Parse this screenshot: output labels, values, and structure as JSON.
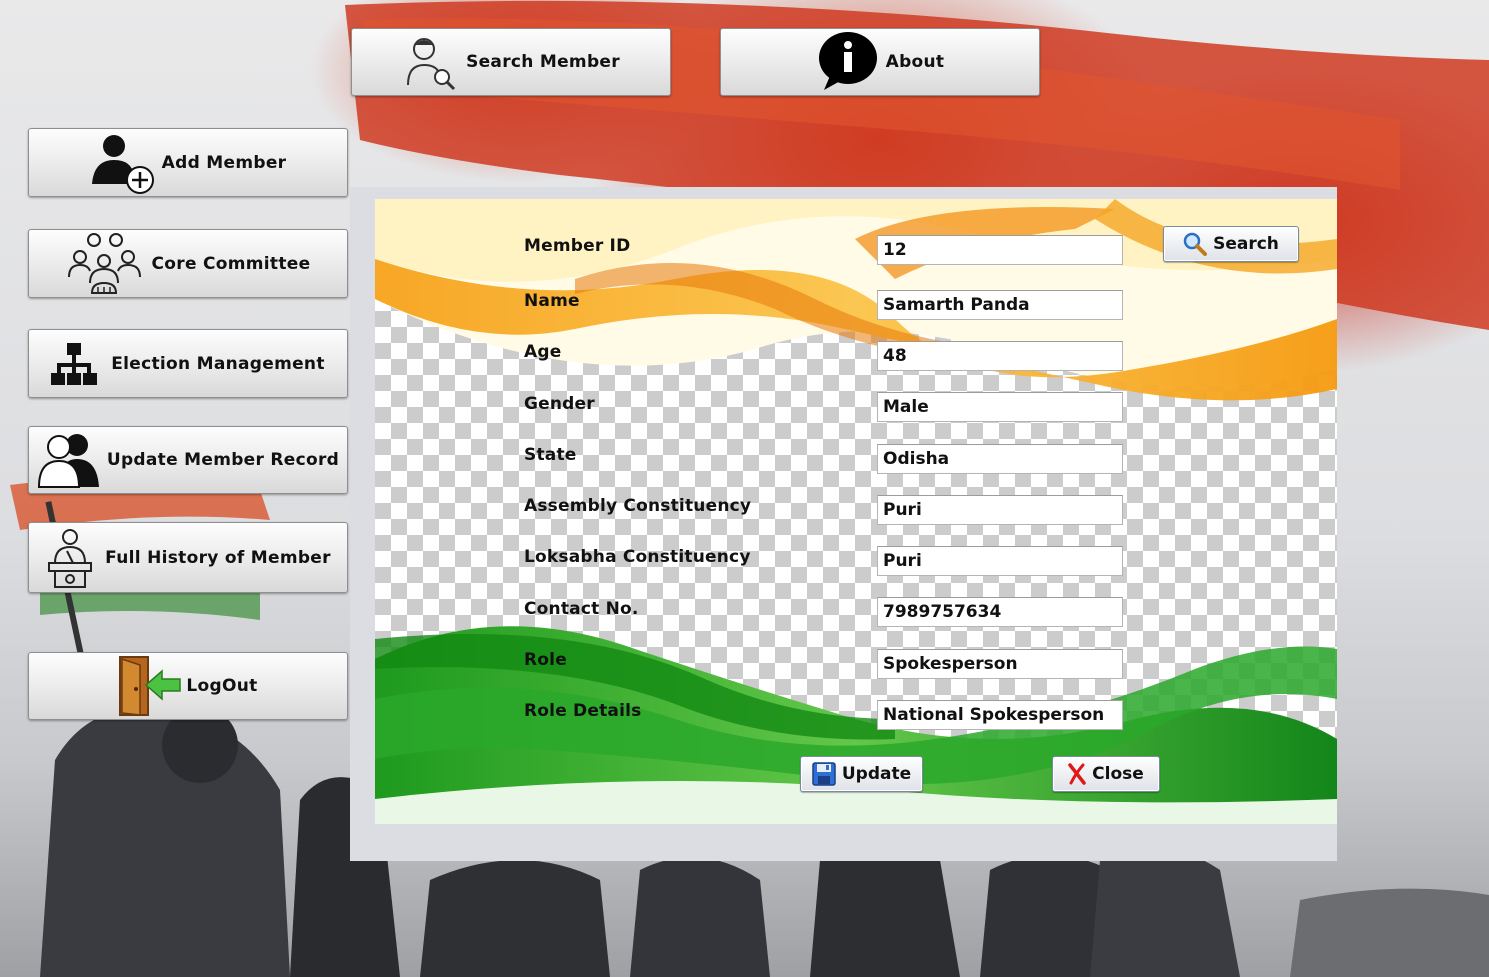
{
  "topbar": {
    "search_member": "Search Member",
    "about": "About"
  },
  "sidebar": {
    "items": [
      {
        "label": "Add Member",
        "icon": "add-user-icon"
      },
      {
        "label": "Core Committee",
        "icon": "group-icon"
      },
      {
        "label": "Election Management",
        "icon": "hierarchy-icon"
      },
      {
        "label": "Update Member Record",
        "icon": "users-icon"
      },
      {
        "label": "Full History of Member",
        "icon": "speaker-icon"
      },
      {
        "label": "LogOut",
        "icon": "logout-door-icon"
      }
    ]
  },
  "form": {
    "search_button": "Search",
    "fields": [
      {
        "label": "Member ID",
        "value": "12"
      },
      {
        "label": "Name",
        "value": "Samarth Panda"
      },
      {
        "label": "Age",
        "value": "48"
      },
      {
        "label": "Gender",
        "value": "Male"
      },
      {
        "label": "State",
        "value": "Odisha"
      },
      {
        "label": "Assembly Constituency",
        "value": "Puri"
      },
      {
        "label": "Loksabha Constituency",
        "value": "Puri"
      },
      {
        "label": "Contact No.",
        "value": "7989757634"
      },
      {
        "label": "Role",
        "value": "Spokesperson"
      },
      {
        "label": "Role Details",
        "value": "National Spokesperson"
      }
    ],
    "update_button": "Update",
    "close_button": "Close"
  },
  "colors": {
    "saffron": "#f39a12",
    "green": "#1f9a1f",
    "flag_red": "#d23c1e"
  }
}
